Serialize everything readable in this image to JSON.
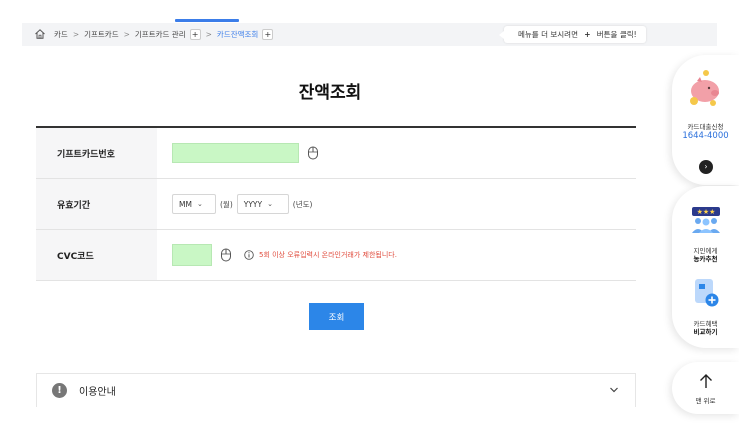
{
  "breadcrumb": {
    "items": [
      "카드",
      "기프트카드",
      "기프트카드 관리"
    ],
    "current": "카드잔액조회",
    "plus_label": "+",
    "tip_before": "메뉴를 더 보시려면",
    "tip_plus": "+",
    "tip_after": "버튼을 클릭!"
  },
  "page": {
    "title": "잔액조회"
  },
  "form": {
    "card_number_label": "기프트카드번호",
    "expiry_label": "유효기간",
    "month_placeholder": "MM",
    "month_unit": "(월)",
    "year_placeholder": "YYYY",
    "year_unit": "(년도)",
    "cvc_label": "CVC코드",
    "cvc_warning": "5회 이상 오류입력시 온라인거래가 제한됩니다."
  },
  "actions": {
    "search_label": "조회"
  },
  "guide": {
    "label": "이용안내"
  },
  "side_panel": {
    "loan_label": "카드대출신청",
    "phone": "1644-4000",
    "referral_line1": "지인에게",
    "referral_line2": "농카추천",
    "compare_line1": "카드혜택",
    "compare_line2": "비교하기",
    "top_label": "맨 위로"
  },
  "colors": {
    "accent": "#2c86e8",
    "input_fill": "#c9f7c5",
    "warning": "#e04b3c",
    "link": "#2a6fdb"
  }
}
